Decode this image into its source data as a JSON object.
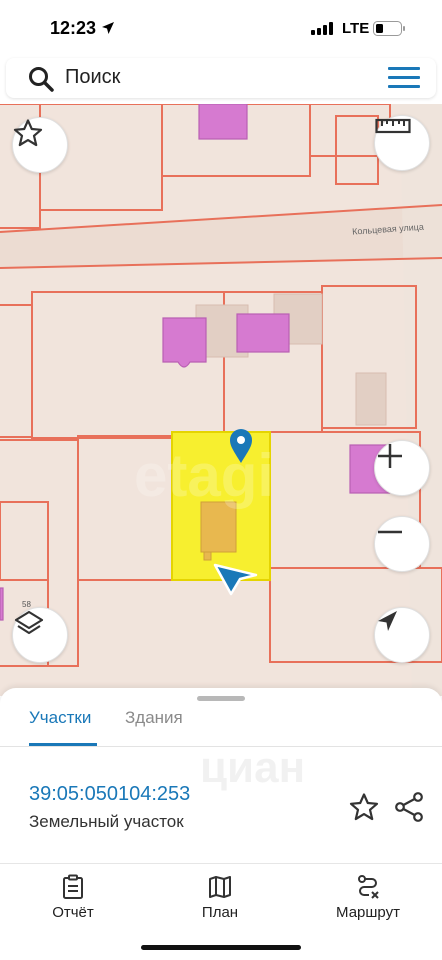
{
  "status_bar": {
    "time": "12:23",
    "network": "LTE"
  },
  "search": {
    "placeholder": "Поиск"
  },
  "map": {
    "street_label": "Кольцевая улица",
    "house_number": "58",
    "watermark": "etagi",
    "colors": {
      "background": "#f1e4dc",
      "parcel_border": "#e8705a",
      "building": "#d67ad0",
      "selected_parcel": "#f7ef2f",
      "marker": "#1a78b8"
    }
  },
  "tabs": {
    "active": "Участки",
    "inactive": "Здания"
  },
  "parcel": {
    "number": "39:05:050104:253",
    "type": "Земельный участок"
  },
  "sheet_watermark": "циан",
  "bottom_nav": [
    {
      "label": "Отчёт",
      "icon": "report-icon"
    },
    {
      "label": "План",
      "icon": "map-book-icon"
    },
    {
      "label": "Маршрут",
      "icon": "route-icon"
    }
  ]
}
